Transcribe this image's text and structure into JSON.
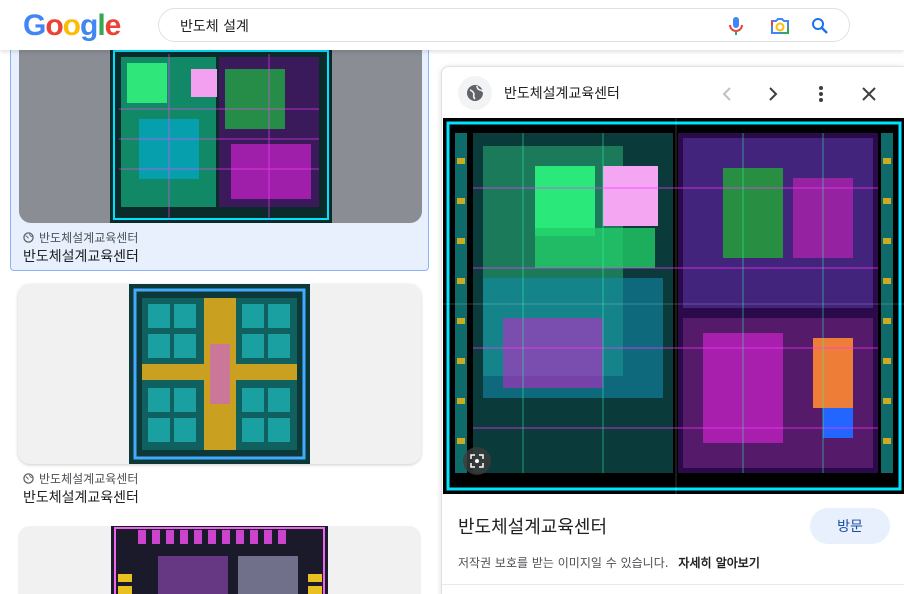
{
  "header": {
    "logo_letters": [
      {
        "char": "G",
        "color": "#4285f4"
      },
      {
        "char": "o",
        "color": "#ea4335"
      },
      {
        "char": "o",
        "color": "#fbbc05"
      },
      {
        "char": "g",
        "color": "#4285f4"
      },
      {
        "char": "l",
        "color": "#34a853"
      },
      {
        "char": "e",
        "color": "#ea4335"
      }
    ],
    "search_query": "반도체 설계",
    "icons": [
      "microphone-icon",
      "camera-lens-icon",
      "search-icon"
    ]
  },
  "results": [
    {
      "source": "반도체설계교육센터",
      "title": "반도체설계교육센터"
    },
    {
      "source": "반도체설계교육센터",
      "title": "반도체설계교육센터"
    }
  ],
  "panel": {
    "source": "반도체설계교육센터",
    "title": "반도체설계교육센터",
    "visit_label": "방문",
    "copyright_text": "저작권 보호를 받는 이미지일 수 있습니다.",
    "learn_more": "자세히 알아보기",
    "icons": [
      "globe-icon",
      "chevron-left-icon",
      "chevron-right-icon",
      "more-vert-icon",
      "close-icon",
      "lens-icon"
    ]
  },
  "colors": {
    "accent_blue": "#1a73e8",
    "selected_bg": "#e8f0fe",
    "selected_border": "#8ab4f8"
  }
}
